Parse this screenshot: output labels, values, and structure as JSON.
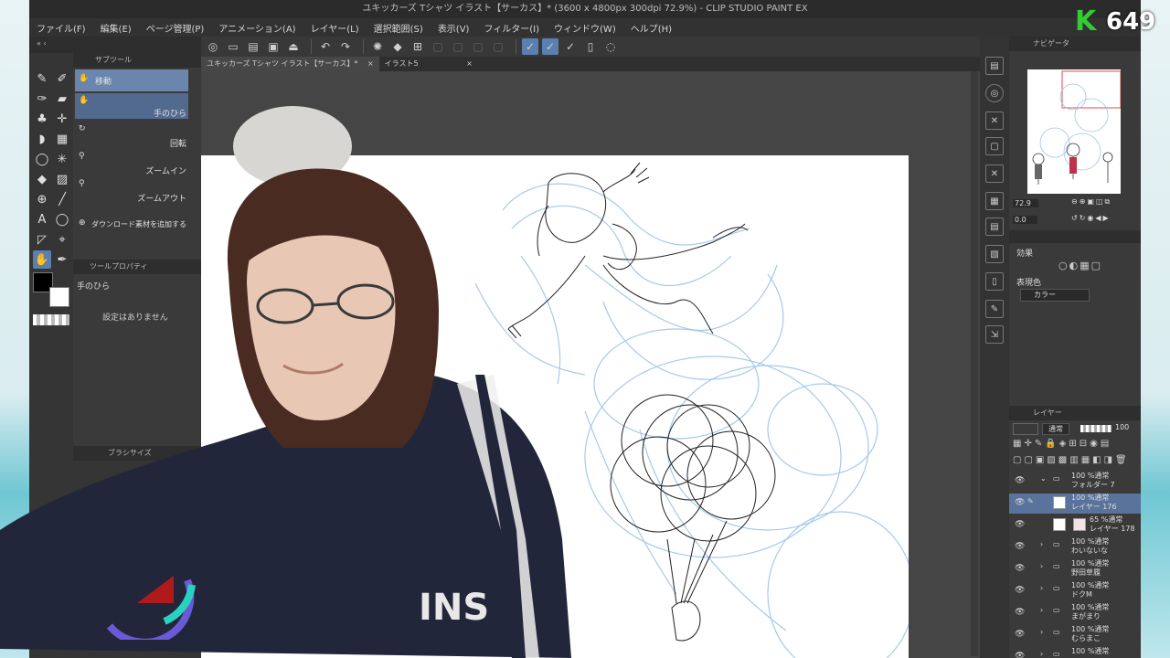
{
  "window": {
    "title": "ユキッカーズ Tシャツ イラスト【サーカス】* (3600 x 4800px 300dpi 72.9%) - CLIP STUDIO PAINT EX"
  },
  "menu": [
    "ファイル(F)",
    "編集(E)",
    "ページ管理(P)",
    "アニメーション(A)",
    "レイヤー(L)",
    "選択範囲(S)",
    "表示(V)",
    "フィルター(I)",
    "ウィンドウ(W)",
    "ヘルプ(H)"
  ],
  "subtool": {
    "header": "サブツール",
    "items": [
      {
        "label": "移動"
      },
      {
        "label": "手のひら"
      },
      {
        "label": "回転"
      },
      {
        "label": "ズームイン"
      },
      {
        "label": "ズームアウト"
      },
      {
        "label": "ダウンロード素材を追加する"
      }
    ]
  },
  "tool_property": {
    "header": "ツールプロパティ",
    "tool_name": "手のひら",
    "empty_message": "設定はありません"
  },
  "brush_size": {
    "header": "ブラシサイズ"
  },
  "canvas_tabs": [
    {
      "label": "ユキッカーズ Tシャツ イラスト【サーカス】*",
      "active": true
    },
    {
      "label": "イラスト5",
      "active": false
    }
  ],
  "navigator": {
    "header": "ナビゲータ",
    "zoom": "72.9",
    "rotation": "0.0"
  },
  "effect": {
    "label": "効果"
  },
  "expression_color": {
    "label": "表現色",
    "value": "カラー"
  },
  "layer_panel": {
    "header": "レイヤー",
    "blend_mode": "通常",
    "opacity": "100",
    "layers": [
      {
        "info": "100 %通常",
        "name": "フォルダー 7",
        "selected": false
      },
      {
        "info": "100 %通常",
        "name": "レイヤー 176",
        "selected": true
      },
      {
        "info": "65 %通常",
        "name": "レイヤー 178",
        "selected": false
      },
      {
        "info": "100 %通常",
        "name": "わいないな",
        "selected": false
      },
      {
        "info": "100 %通常",
        "name": "野田草履",
        "selected": false
      },
      {
        "info": "100 %通常",
        "name": "ドクM",
        "selected": false
      },
      {
        "info": "100 %通常",
        "name": "まがまり",
        "selected": false
      },
      {
        "info": "100 %通常",
        "name": "むらまこ",
        "selected": false
      },
      {
        "info": "100 %通常",
        "name": "",
        "selected": false
      }
    ]
  },
  "overlay": {
    "logo_letter": "K",
    "count": "649"
  },
  "webcam": {
    "shirt_text": "INS"
  },
  "colors": {
    "accent": "#6b86ad",
    "layer_selected": "#59739a",
    "sketch_blue": "#9cc4ea",
    "counter_green": "#33cc33"
  }
}
